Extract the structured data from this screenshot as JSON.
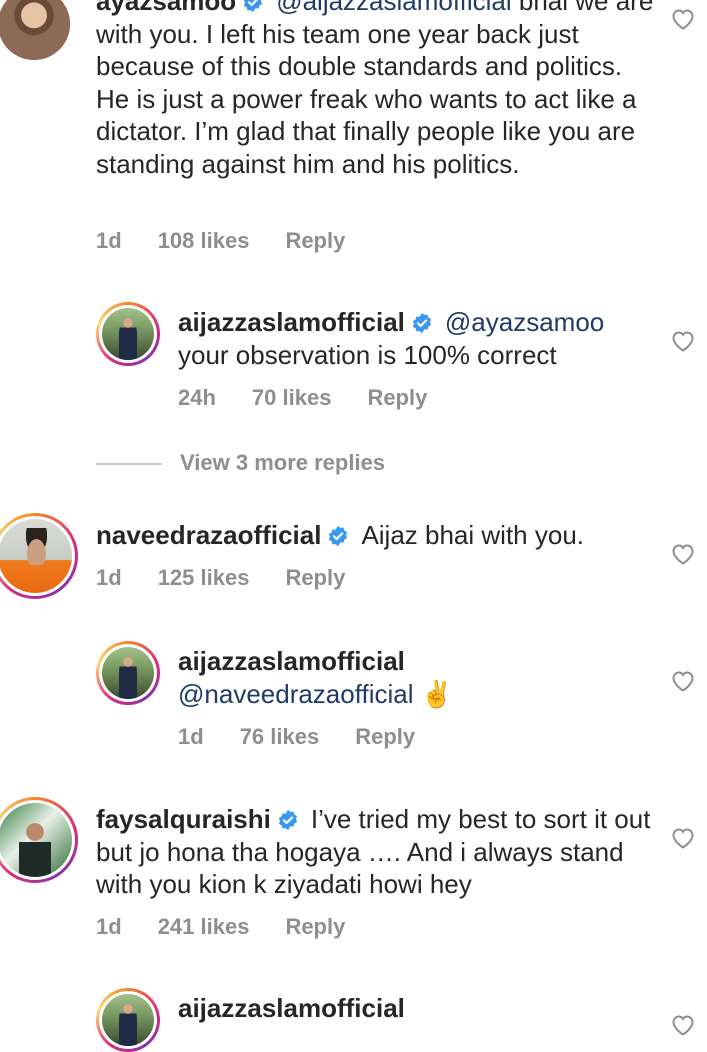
{
  "comments": [
    {
      "username": "ayazsamoo",
      "mention": "@aijazzaslamofficial",
      "text_after_mention": " bhai we are with you. I left his team one year back just because of this double standards and politics. He is just a power freak who wants to act like a dictator. I’m glad that finally people like you are standing against him and his politics.",
      "time": "1d",
      "likes": "108 likes",
      "reply": "Reply"
    },
    {
      "username": "aijazzaslamofficial",
      "mention": "@ayazsamoo",
      "text": "your observation is 100% correct",
      "time": "24h",
      "likes": "70 likes",
      "reply": "Reply"
    },
    {
      "view_more": "View 3 more replies"
    },
    {
      "username": "naveedrazaofficial",
      "text": "Aijaz bhai with you.",
      "time": "1d",
      "likes": "125 likes",
      "reply": "Reply"
    },
    {
      "username": "aijazzaslamofficial",
      "mention": "@naveedrazaofficial",
      "emoji": "✌️",
      "time": "1d",
      "likes": "76 likes",
      "reply": "Reply"
    },
    {
      "username": "faysalquraishi",
      "text": "I’ve tried my best to sort it out but jo hona tha hogaya …. And i always stand with you kion k ziyadati howi hey",
      "time": "1d",
      "likes": "241 likes",
      "reply": "Reply"
    },
    {
      "username": "aijazzaslamofficial"
    }
  ],
  "icons": {
    "verified": "verified-badge-icon",
    "like": "heart-outline-icon"
  },
  "colors": {
    "verified": "#3897f0",
    "mention": "#1f3c68",
    "meta": "#8e8e8e"
  }
}
